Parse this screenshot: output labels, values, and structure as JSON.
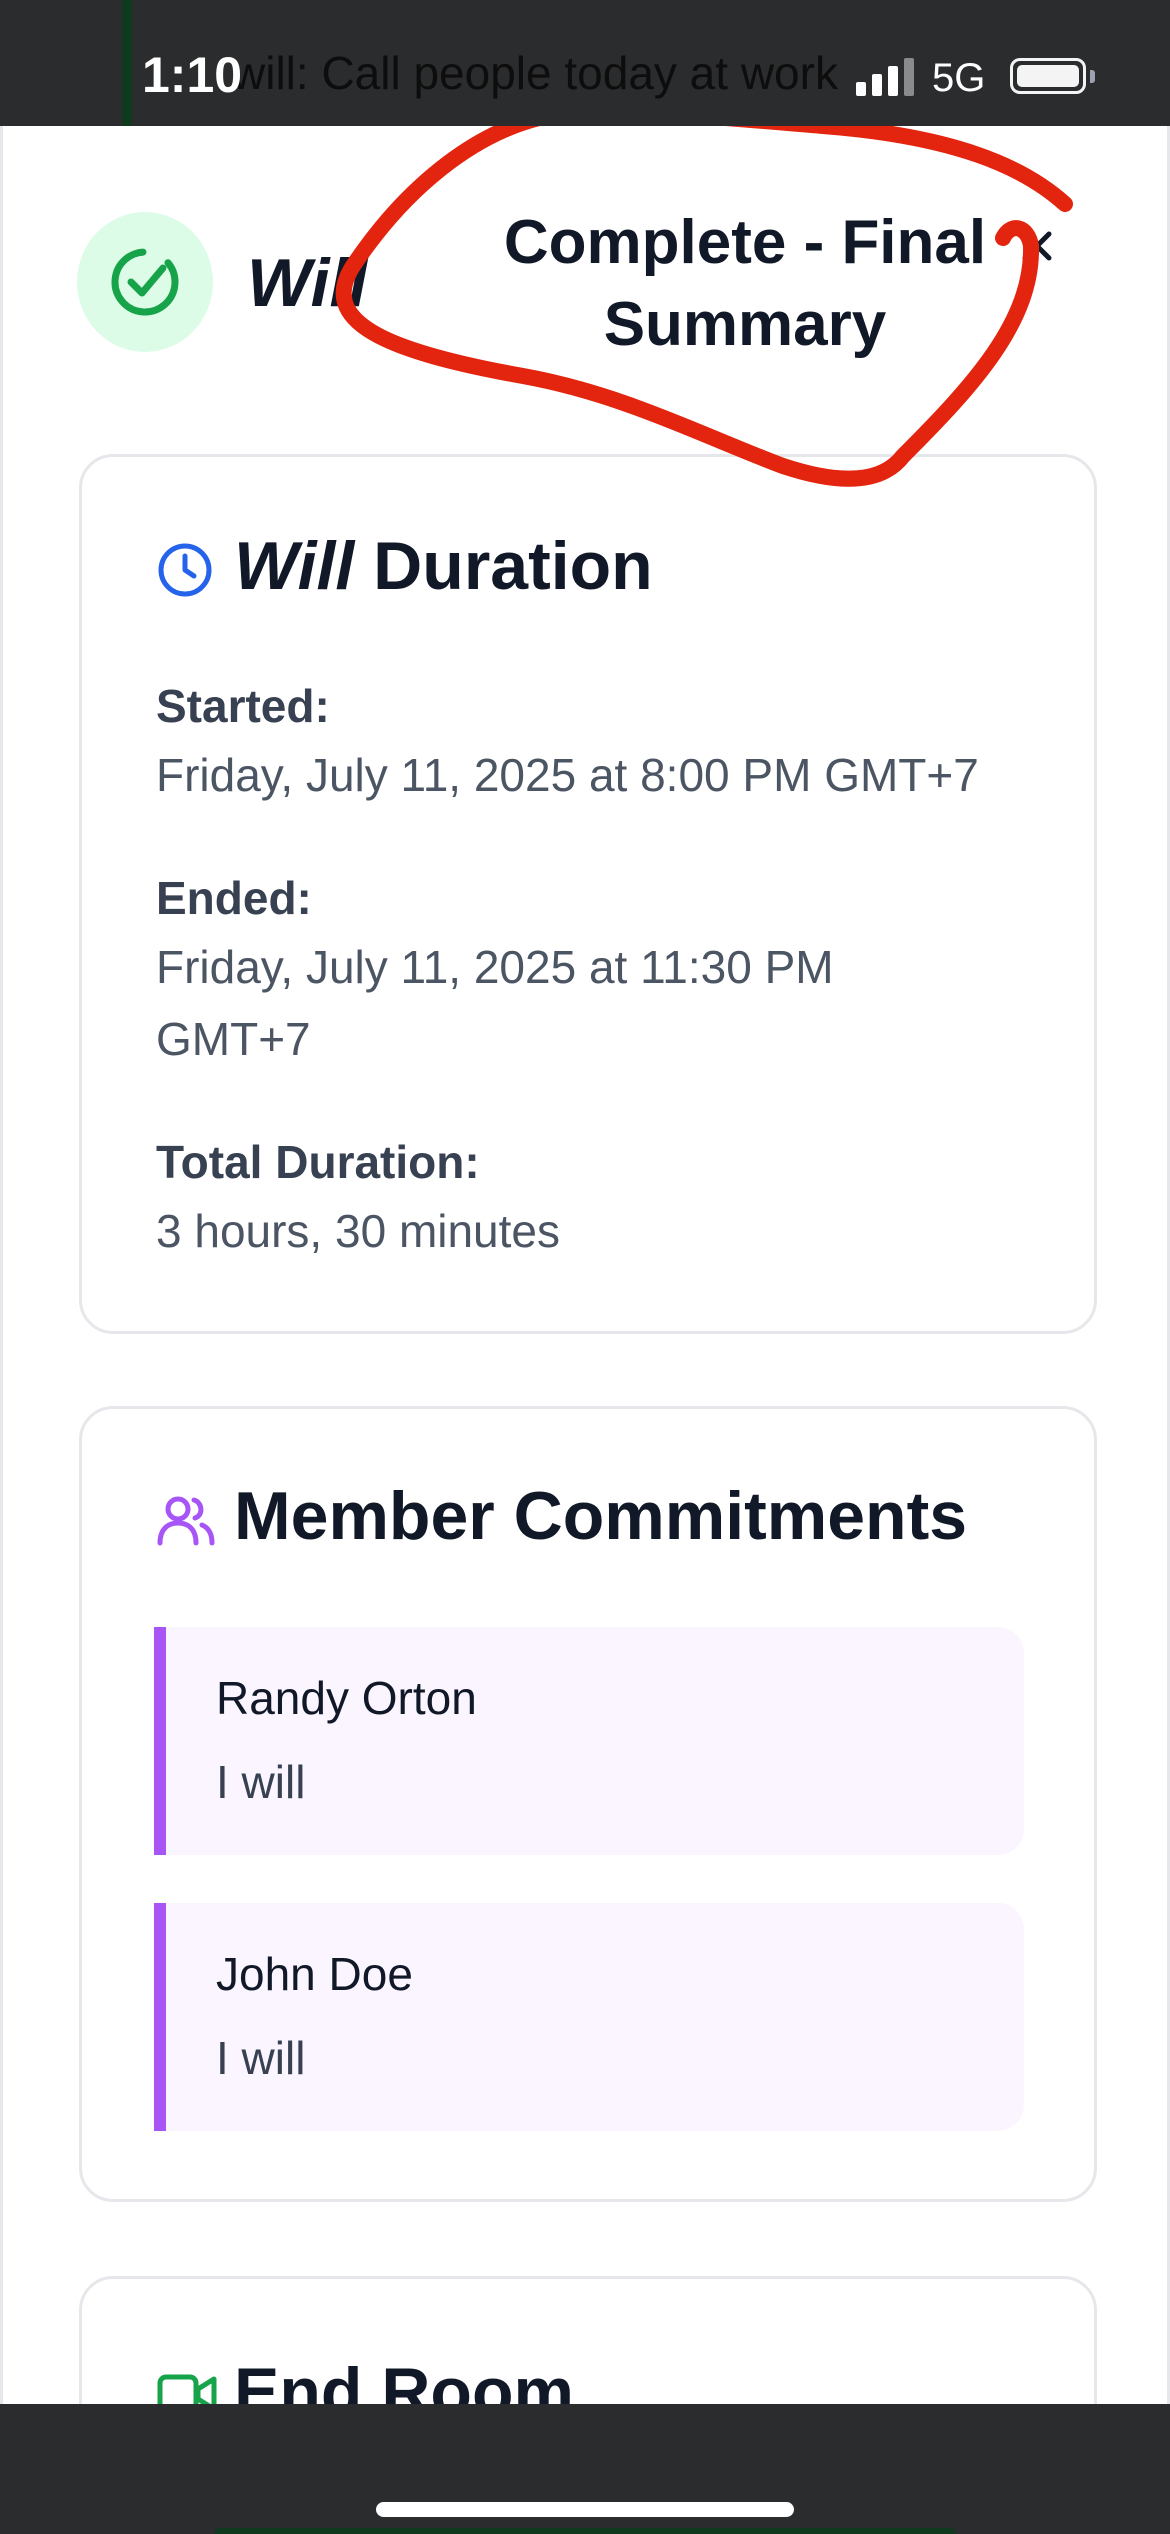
{
  "status_bar": {
    "time": "1:10",
    "background_text": "will: Call people today at work",
    "network": "5G"
  },
  "modal": {
    "title_prefix": "Will",
    "title_suffix": "Complete - Final Summary",
    "icons": {
      "header": "check-circle-icon",
      "close": "close-icon"
    },
    "colors": {
      "success": "#16a34a",
      "success_bg": "#dcfce7",
      "annotation": "#e3240e"
    }
  },
  "duration_card": {
    "title_em": "Will",
    "title_rest": "Duration",
    "icon": "clock-icon",
    "icon_color": "#2563eb",
    "started_label": "Started:",
    "started_value": "Friday, July 11, 2025 at 8:00 PM GMT+7",
    "ended_label": "Ended:",
    "ended_value": "Friday, July 11, 2025 at 11:30 PM GMT+7",
    "total_label": "Total Duration:",
    "total_value": "3 hours, 30 minutes"
  },
  "members_card": {
    "title": "Member Commitments",
    "icon": "users-icon",
    "icon_color": "#a855f7",
    "members": [
      {
        "name": "Randy Orton",
        "commitment": "I will"
      },
      {
        "name": "John Doe",
        "commitment": "I will"
      }
    ]
  },
  "end_room_card": {
    "title": "End Room",
    "icon": "video-icon",
    "icon_color": "#16a34a"
  }
}
